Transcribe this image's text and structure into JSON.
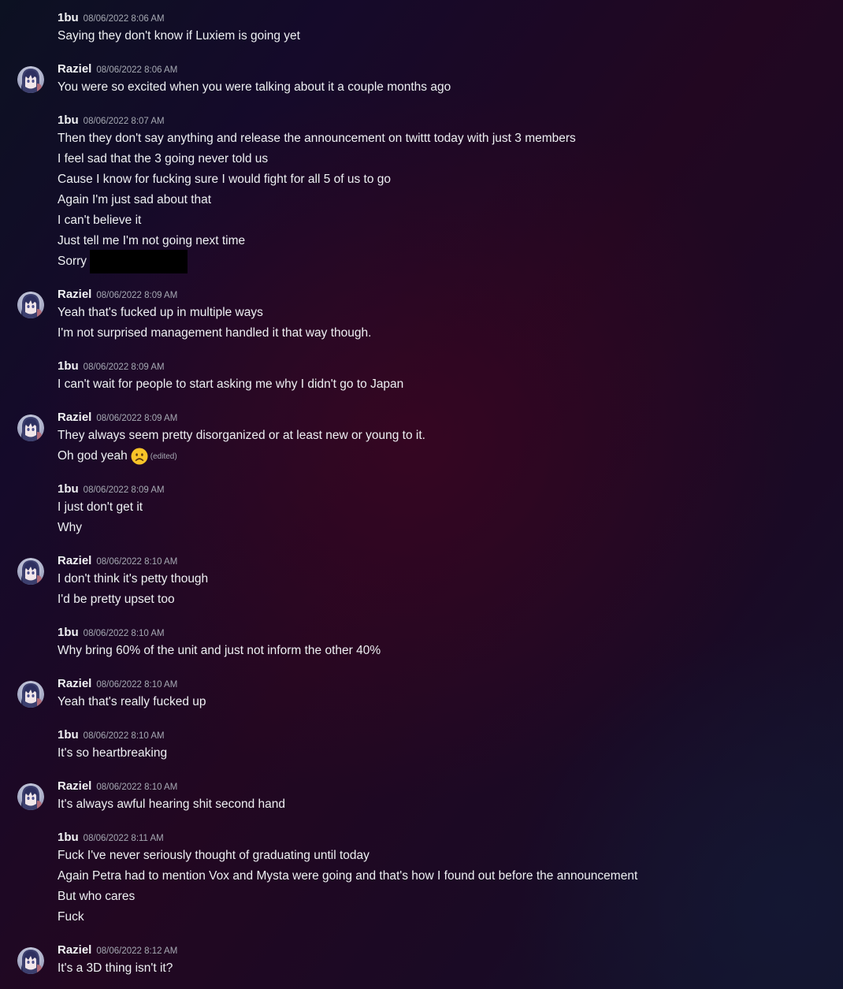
{
  "users": {
    "a": "1bu",
    "b": "Raziel"
  },
  "messages": [
    {
      "author": "1bu",
      "time": "08/06/2022 8:06 AM",
      "lines": [
        "Saying they don't know if Luxiem is going yet"
      ]
    },
    {
      "author": "Raziel",
      "time": "08/06/2022 8:06 AM",
      "lines": [
        "You were so excited when you were talking about it a couple months ago"
      ]
    },
    {
      "author": "1bu",
      "time": "08/06/2022 8:07 AM",
      "lines": [
        "Then they don't say anything and release the announcement on twittt today with just 3 members",
        "I feel sad that the 3 going never told us",
        "Cause I know for fucking sure I would fight for all 5 of us to go",
        "Again I'm just sad about that",
        "I can't believe it",
        "Just tell me I'm not going next time",
        "Sorry"
      ]
    },
    {
      "author": "Raziel",
      "time": "08/06/2022 8:09 AM",
      "lines": [
        "Yeah that's fucked up in multiple ways",
        "I'm not surprised management handled it that way though."
      ]
    },
    {
      "author": "1bu",
      "time": "08/06/2022 8:09 AM",
      "lines": [
        "I can't wait for people to start asking me why I didn't go to Japan"
      ]
    },
    {
      "author": "Raziel",
      "time": "08/06/2022 8:09 AM",
      "lines": [
        "They always seem pretty disorganized or at least new or young to it.",
        "Oh god yeah"
      ],
      "edited_label": "(edited)"
    },
    {
      "author": "1bu",
      "time": "08/06/2022 8:09 AM",
      "lines": [
        "I just don't get it",
        "Why"
      ]
    },
    {
      "author": "Raziel",
      "time": "08/06/2022 8:10 AM",
      "lines": [
        "I don't think it's petty though",
        "I'd be pretty upset too"
      ]
    },
    {
      "author": "1bu",
      "time": "08/06/2022 8:10 AM",
      "lines": [
        "Why bring 60% of the unit and just not inform the other 40%"
      ]
    },
    {
      "author": "Raziel",
      "time": "08/06/2022 8:10 AM",
      "lines": [
        "Yeah that's really fucked up"
      ]
    },
    {
      "author": "1bu",
      "time": "08/06/2022 8:10 AM",
      "lines": [
        "It's so heartbreaking"
      ]
    },
    {
      "author": "Raziel",
      "time": "08/06/2022 8:10 AM",
      "lines": [
        "It's always awful hearing shit second hand"
      ]
    },
    {
      "author": "1bu",
      "time": "08/06/2022 8:11 AM",
      "lines": [
        "Fuck I've never seriously thought of graduating until today",
        "Again Petra had to mention Vox and Mysta were going and that's how I found out before the announcement",
        "But who cares",
        "Fuck"
      ]
    },
    {
      "author": "Raziel",
      "time": "08/06/2022 8:12 AM",
      "lines": [
        "It's a 3D thing isn't it?"
      ]
    }
  ],
  "icons": {
    "avatar": "raziel-avatar",
    "emoji": "frowning-face-emoji",
    "redaction": "redacted-text-block"
  },
  "colors": {
    "username": "#f2f3f5",
    "timestamp": "#a6a9b3",
    "message_text": "#eef0f3",
    "emoji": "#f8c328",
    "redaction": "#000000"
  }
}
